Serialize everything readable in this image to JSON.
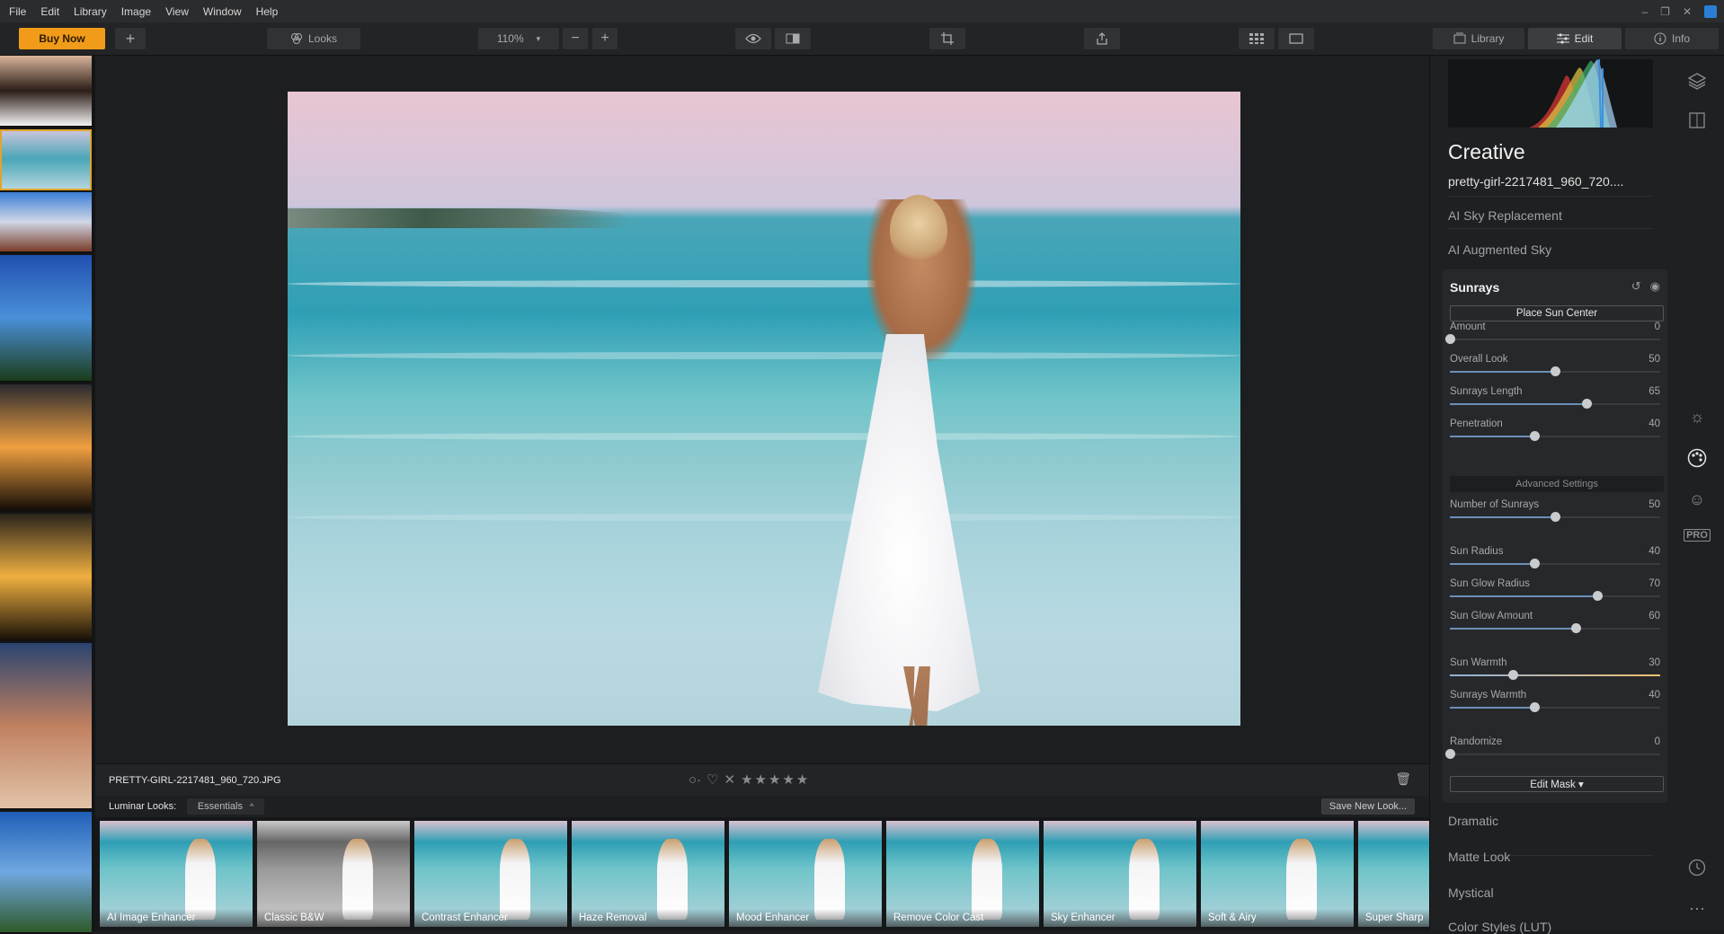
{
  "menu": [
    "File",
    "Edit",
    "Library",
    "Image",
    "View",
    "Window",
    "Help"
  ],
  "window_controls": [
    "–",
    "❐",
    "✕"
  ],
  "toolbar": {
    "buy_now": "Buy Now",
    "add": "+",
    "looks": "Looks",
    "zoom": "110%",
    "zoom_minus": "−",
    "zoom_plus": "+",
    "library": "Library",
    "edit": "Edit",
    "info": "Info"
  },
  "filmstrip": {
    "selected_index": 1,
    "thumbs": [
      {
        "colors": [
          "#d9b49a",
          "#2b1d17",
          "#f2f2f2"
        ]
      },
      {
        "colors": [
          "#cfc6dc",
          "#4aa6b8",
          "#b4d4dc"
        ]
      },
      {
        "colors": [
          "#3a7fd6",
          "#d0d7e6",
          "#7a3d2a"
        ]
      },
      {
        "colors": [
          "#2050b0",
          "#4a90d8",
          "#1b3d1b"
        ]
      },
      {
        "colors": [
          "#2a2a30",
          "#f0a040",
          "#150d08"
        ]
      },
      {
        "colors": [
          "#2a241c",
          "#f0b040",
          "#1a1208"
        ]
      },
      {
        "colors": [
          "#2a4470",
          "#c08060",
          "#e2c3a8"
        ]
      },
      {
        "colors": [
          "#1f5fb8",
          "#6fa8e0",
          "#2f5a2a"
        ]
      }
    ]
  },
  "info_bar": {
    "filename": "PRETTY-GIRL-2217481_960_720.JPG",
    "flag_icon": "○·",
    "heart_icon": "♡",
    "reject_icon": "✕",
    "stars": "★★★★★"
  },
  "looks_bar": {
    "label": "Luminar Looks:",
    "category": "Essentials",
    "save_button": "Save New Look..."
  },
  "looks": [
    {
      "label": "AI Image Enhancer",
      "bw": false
    },
    {
      "label": "Classic B&W",
      "bw": true
    },
    {
      "label": "Contrast Enhancer",
      "bw": false
    },
    {
      "label": "Haze Removal",
      "bw": false
    },
    {
      "label": "Mood Enhancer",
      "bw": false
    },
    {
      "label": "Remove Color Cast",
      "bw": false
    },
    {
      "label": "Sky Enhancer",
      "bw": false
    },
    {
      "label": "Soft & Airy",
      "bw": false
    },
    {
      "label": "Super Sharp",
      "bw": false
    }
  ],
  "panel": {
    "title": "Creative",
    "subtitle": "pretty-girl-2217481_960_720....",
    "sections_above": [
      "AI Sky Replacement",
      "AI Augmented Sky"
    ],
    "sunrays": {
      "title": "Sunrays",
      "place_sun": "Place Sun Center",
      "advanced": "Advanced Settings",
      "edit_mask": "Edit Mask ▾",
      "sliders": [
        {
          "label": "Amount",
          "value": 0,
          "max": 100,
          "warm": false
        },
        {
          "label": "Overall Look",
          "value": 50,
          "max": 100,
          "warm": false
        },
        {
          "label": "Sunrays Length",
          "value": 65,
          "max": 100,
          "warm": false
        },
        {
          "label": "Penetration",
          "value": 40,
          "max": 100,
          "warm": false
        },
        {
          "label": "Number of Sunrays",
          "value": 50,
          "max": 100,
          "warm": false
        },
        {
          "label": "Sun Radius",
          "value": 40,
          "max": 100,
          "warm": false
        },
        {
          "label": "Sun Glow Radius",
          "value": 70,
          "max": 100,
          "warm": false
        },
        {
          "label": "Sun Glow Amount",
          "value": 60,
          "max": 100,
          "warm": false
        },
        {
          "label": "Sun Warmth",
          "value": 30,
          "max": 100,
          "warm": true
        },
        {
          "label": "Sunrays Warmth",
          "value": 40,
          "max": 100,
          "warm": false
        },
        {
          "label": "Randomize",
          "value": 0,
          "max": 100,
          "warm": false
        }
      ]
    },
    "sections_below": [
      "Dramatic",
      "Matte Look",
      "Mystical",
      "Color Styles (LUT)"
    ]
  },
  "colors": {
    "accent": "#f09c1a",
    "slider_fill": "#6c8fb8",
    "selection": "#e0a52a"
  }
}
